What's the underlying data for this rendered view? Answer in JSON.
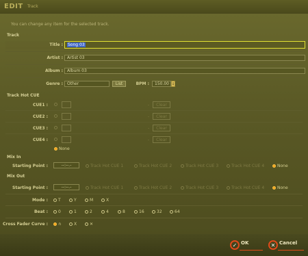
{
  "title": {
    "brand": "EDIT",
    "subtitle": "Track"
  },
  "hint": "You can change any item for the selected track.",
  "track": {
    "section": "Track",
    "title_label": "Title :",
    "title_value": "Song 03",
    "artist_label": "Artist :",
    "artist_value": "Artist 03",
    "album_label": "Album :",
    "album_value": "Album 03",
    "genre_label": "Genre :",
    "genre_value": "Other",
    "list_button": "List",
    "bpm_label": "BPM :",
    "bpm_value": "150.00"
  },
  "hotcue": {
    "section": "Track Hot CUE",
    "cues": [
      {
        "label": "CUE1 :",
        "dash": "-",
        "clear": "Clear"
      },
      {
        "label": "CUE2 :",
        "dash": "-",
        "clear": "Clear"
      },
      {
        "label": "CUE3 :",
        "dash": "-",
        "clear": "Clear"
      },
      {
        "label": "CUE4 :",
        "dash": "-",
        "clear": "Clear"
      }
    ],
    "none_label": "None"
  },
  "mixin": {
    "section": "Mix In",
    "starting_label": "Starting Point :",
    "time_value": "--:--.-",
    "options": [
      "Track Hot CUE 1",
      "Track Hot CUE 2",
      "Track Hot CUE 3",
      "Track Hot CUE 4",
      "None"
    ]
  },
  "mixout": {
    "section": "Mix Out",
    "starting_label": "Starting Point :",
    "time_value": "--:--.-",
    "options": [
      "Track Hot CUE 1",
      "Track Hot CUE 2",
      "Track Hot CUE 3",
      "Track Hot CUE 4",
      "None"
    ],
    "mode_label": "Mode :",
    "mode_options": [
      "T",
      "Y",
      "M",
      "X"
    ],
    "beat_label": "Beat :",
    "beat_options": [
      "0",
      "1",
      "2",
      "4",
      "8",
      "16",
      "32",
      "64"
    ],
    "curve_label": "Cross Fader Curve :",
    "curve_options": [
      "∩",
      "X",
      "✕"
    ]
  },
  "actions": {
    "ok": "OK",
    "cancel": "Cancel"
  },
  "colors": {
    "accent": "#e04a1a",
    "selected_radio": "#f2a21a",
    "active_border": "#e3e233"
  }
}
